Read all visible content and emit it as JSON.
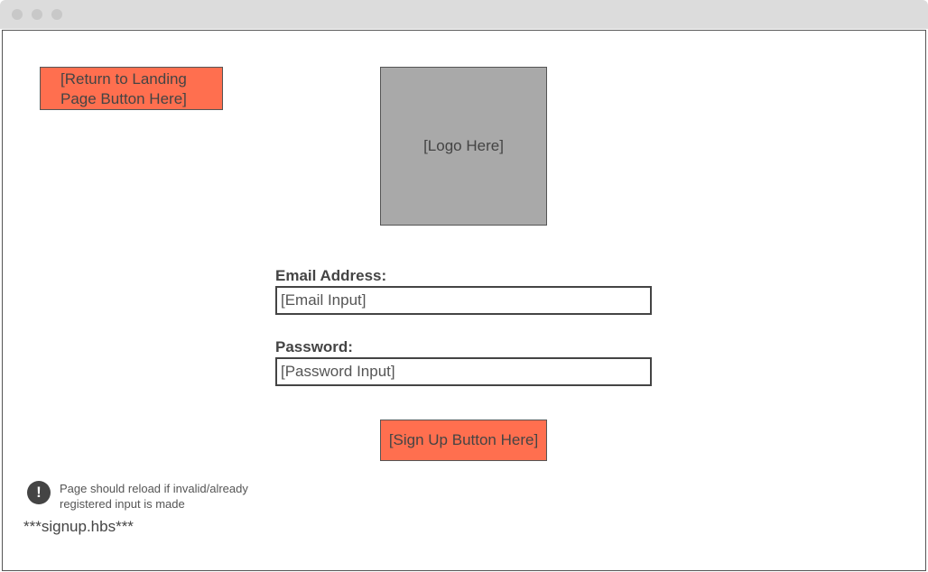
{
  "window": {
    "controls": [
      "close-dot",
      "minimize-dot",
      "maximize-dot"
    ]
  },
  "page": {
    "return_button": "[Return to Landing Page Button Here]",
    "logo_placeholder": "[Logo Here]",
    "email": {
      "label": "Email Address:",
      "input_placeholder": "[Email Input]"
    },
    "password": {
      "label": "Password:",
      "input_placeholder": "[Password Input]"
    },
    "signup_button": "[Sign Up Button Here]",
    "note": {
      "icon": "exclamation-icon",
      "icon_glyph": "!",
      "text": "Page should reload if invalid/already registered input is made"
    },
    "file_label": "***signup.hbs***"
  },
  "colors": {
    "button_fill": "#ff6f4f",
    "logo_fill": "#a9a9a9",
    "titlebar": "#dcdcdc"
  }
}
